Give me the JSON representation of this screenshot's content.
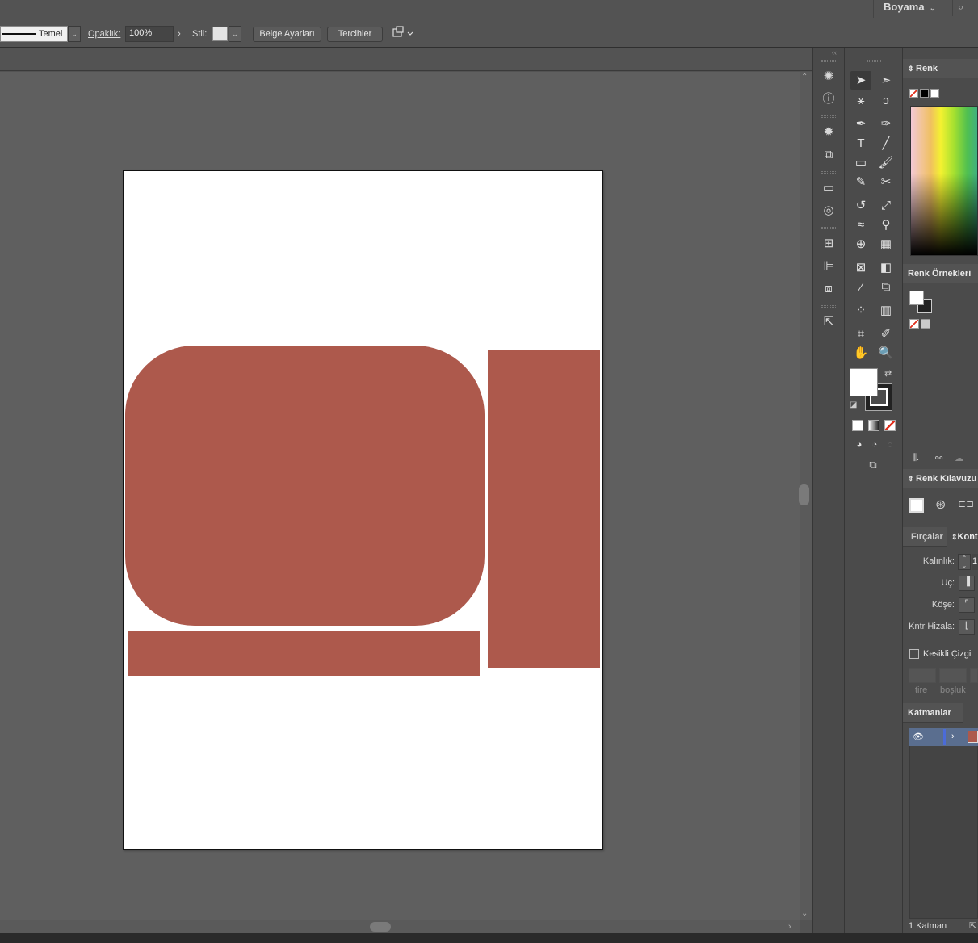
{
  "topbar": {
    "workspace_label": "Boyama",
    "workspace_chevron": "⌄",
    "search_icon": "⌕"
  },
  "control_bar": {
    "stroke_profile_label": "Temel",
    "opacity_label": "Opaklık:",
    "opacity_value": "100%",
    "style_label": "Stil:",
    "document_settings_button": "Belge Ayarları",
    "preferences_button": "Tercihler",
    "dropdown_glyph": "⌄",
    "arrow_glyph": "›"
  },
  "dock": {
    "icons": [
      "sun-icon",
      "info-icon",
      "symbols-icon",
      "transform-icon",
      "gradient-icon",
      "appearance-icon",
      "artboards-icon",
      "align-icon",
      "pathfinder-icon",
      "export-icon"
    ]
  },
  "toolbar": {
    "tools": [
      "selection",
      "direct-selection",
      "magic-wand",
      "lasso",
      "pen",
      "curvature",
      "type",
      "line-segment",
      "rectangle",
      "paintbrush",
      "shaper",
      "scissors",
      "rotate",
      "scale",
      "warp",
      "puppet-warp",
      "shape-builder",
      "perspective-grid",
      "mesh",
      "gradient",
      "eyedropper",
      "blend",
      "symbol-sprayer",
      "column-graph",
      "artboard",
      "slice",
      "hand",
      "zoom"
    ],
    "fill_color": "#ffffff",
    "stroke_color": "#000000"
  },
  "artboard": {
    "background": "#ffffff",
    "shape_color": "#ad594c"
  },
  "panels": {
    "color": {
      "title": "Renk"
    },
    "swatches": {
      "title": "Renk Örnekleri"
    },
    "color_guide": {
      "title": "Renk Kılavuzu"
    },
    "brushes_tab": "Fırçalar",
    "stroke_tab": "Kont",
    "stroke": {
      "weight_label": "Kalınlık:",
      "weight_value": "1",
      "cap_label": "Uç:",
      "corner_label": "Köşe:",
      "align_label": "Kntr Hizala:",
      "dashed_label": "Kesikli Çizgi",
      "dash_label": "tire",
      "gap_label": "boşluk"
    },
    "layers": {
      "title": "Katmanlar",
      "count_label": "1 Katman"
    }
  }
}
